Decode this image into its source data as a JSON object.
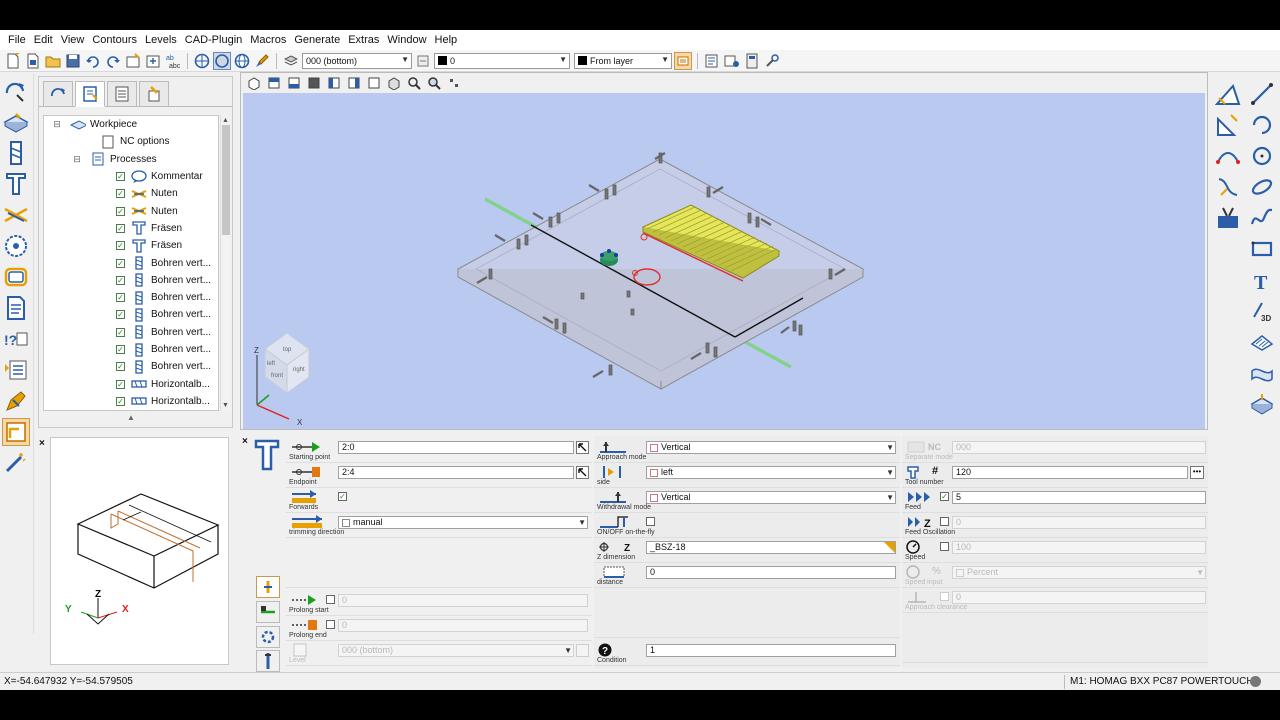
{
  "menu": [
    "File",
    "Edit",
    "View",
    "Contours",
    "Levels",
    "CAD-Plugin",
    "Macros",
    "Generate",
    "Extras",
    "Window",
    "Help"
  ],
  "toolbar": {
    "level_select": "000  (bottom)",
    "color_select": "0",
    "linetype_select": "From layer"
  },
  "tree": {
    "root": "Workpiece",
    "nc_options": "NC options",
    "processes": "Processes",
    "items": [
      {
        "label": "Kommentar",
        "icon": "comment-icon"
      },
      {
        "label": "Nuten",
        "icon": "groove-icon"
      },
      {
        "label": "Nuten",
        "icon": "groove-icon"
      },
      {
        "label": "Fräsen",
        "icon": "milling-icon"
      },
      {
        "label": "Fräsen",
        "icon": "milling-icon"
      },
      {
        "label": "Bohren vert...",
        "icon": "drill-icon"
      },
      {
        "label": "Bohren vert...",
        "icon": "drill-icon"
      },
      {
        "label": "Bohren vert...",
        "icon": "drill-icon"
      },
      {
        "label": "Bohren vert...",
        "icon": "drill-icon"
      },
      {
        "label": "Bohren vert...",
        "icon": "drill-icon"
      },
      {
        "label": "Bohren vert...",
        "icon": "drill-icon"
      },
      {
        "label": "Bohren vert...",
        "icon": "drill-icon"
      },
      {
        "label": "Horizontalb...",
        "icon": "horizontal-drill-icon"
      },
      {
        "label": "Horizontalb...",
        "icon": "horizontal-drill-icon"
      }
    ]
  },
  "viewcube": {
    "top": "top",
    "left": "left",
    "front": "front",
    "right": "right",
    "z": "Z",
    "x": "X"
  },
  "preview_axes": {
    "z": "Z",
    "y": "Y",
    "x": "X"
  },
  "params": {
    "starting_point": {
      "label": "Starting point",
      "value": "2:0"
    },
    "endpoint": {
      "label": "Endpoint",
      "value": "2:4"
    },
    "forwards": {
      "label": "Forwards",
      "checked": true
    },
    "trimming_direction": {
      "label": "trimming direction",
      "value": "manual"
    },
    "prolong_start": {
      "label": "Prolong start",
      "value": "0"
    },
    "prolong_end": {
      "label": "Prolong end",
      "value": "0"
    },
    "level": {
      "label": "Level",
      "value": "000  (bottom)"
    },
    "approach_mode": {
      "label": "Approach mode",
      "value": "Vertical"
    },
    "side": {
      "label": "side",
      "value": "left"
    },
    "withdrawal_mode": {
      "label": "Withdrawal mode",
      "value": "Vertical"
    },
    "on_off_fly": {
      "label": "ON/OFF on-the-fly"
    },
    "z_dimension": {
      "label": "Z dimension",
      "value": "_BSZ-18",
      "symbol": "Z"
    },
    "distance": {
      "label": "distance",
      "value": "0"
    },
    "condition": {
      "label": "Condition",
      "value": "1"
    },
    "separate_mode": {
      "label": "Separate mode",
      "prefix": "NC",
      "value": "000"
    },
    "tool_number": {
      "label": "Tool number",
      "symbol": "#",
      "value": "120"
    },
    "feed": {
      "label": "Feed",
      "value": "5"
    },
    "feed_oscillation": {
      "label": "Feed Oscillation",
      "value": "0"
    },
    "speed": {
      "label": "Speed",
      "value": "100"
    },
    "speed_input": {
      "label": "Speed input",
      "symbol": "%",
      "value": "Percent"
    },
    "approach_clearance": {
      "label": "Approach clearance",
      "value": "0"
    }
  },
  "status": {
    "coords": "X=-54.647932 Y=-54.579505",
    "machine": "M1: HOMAG BXX PC87 POWERTOUCH"
  },
  "colors": {
    "viewport_bg": "#b9c9ef",
    "workpiece_edge": "#8a8a8a",
    "groove_fill": "#e6e65a",
    "axis_green": "#7ad47a",
    "highlight_red": "#e03030",
    "axis_red": "#e02020",
    "axis_green_dark": "#1aa01a",
    "icon_blue": "#2a5ea8"
  }
}
